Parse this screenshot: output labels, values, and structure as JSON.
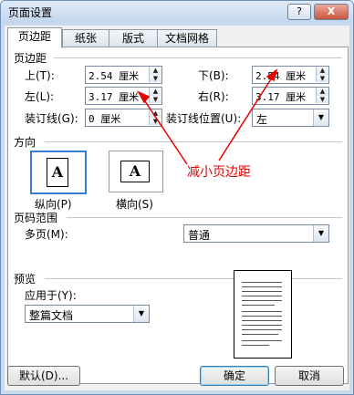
{
  "window": {
    "title": "页面设置",
    "help_btn": "?",
    "close_btn": "X"
  },
  "tabs": [
    {
      "label": "页边距",
      "active": true
    },
    {
      "label": "纸张",
      "active": false
    },
    {
      "label": "版式",
      "active": false
    },
    {
      "label": "文档网格",
      "active": false
    }
  ],
  "margins": {
    "group_label": "页边距",
    "top": {
      "label": "上(T):",
      "value": "2.54 厘米"
    },
    "bottom": {
      "label": "下(B):",
      "value": "2.54 厘米"
    },
    "left": {
      "label": "左(L):",
      "value": "3.17 厘米"
    },
    "right": {
      "label": "右(R):",
      "value": "3.17 厘米"
    },
    "gutter": {
      "label": "装订线(G):",
      "value": "0 厘米"
    },
    "gutter_pos": {
      "label": "装订线位置(U):",
      "value": "左"
    }
  },
  "orientation": {
    "group_label": "方向",
    "portrait": {
      "glyph": "A",
      "label": "纵向(P)",
      "selected": true
    },
    "landscape": {
      "glyph": "A",
      "label": "横向(S)",
      "selected": false
    }
  },
  "annotation": {
    "text": "减小页边距",
    "color": "#e60000"
  },
  "page_range": {
    "group_label": "页码范围",
    "multi_label": "多页(M):",
    "multi_value": "普通"
  },
  "preview": {
    "group_label": "预览",
    "apply_label": "应用于(Y):",
    "apply_value": "整篇文档"
  },
  "buttons": {
    "default": "默认(D)...",
    "ok": "确定",
    "cancel": "取消"
  },
  "icons": {
    "spin_up": "▲",
    "spin_down": "▼",
    "dropdown": "▼"
  }
}
